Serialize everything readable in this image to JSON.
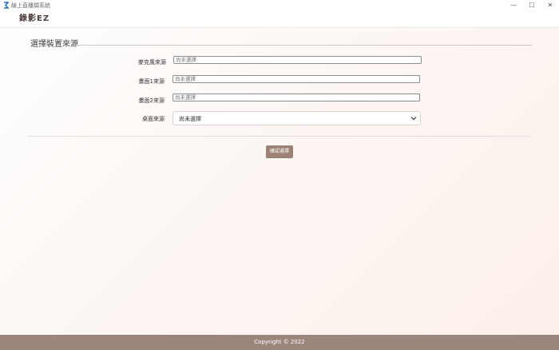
{
  "window": {
    "title": "線上直播擷系統",
    "minimize_glyph": "—",
    "maximize_glyph": "☐",
    "close_glyph": "✕"
  },
  "header": {
    "brand": "錄影EZ"
  },
  "form": {
    "section_title": "選擇裝置來源",
    "fields": [
      {
        "label": "麥克風來源",
        "placeholder": "尚未選擇"
      },
      {
        "label": "畫面1來源",
        "placeholder": "尚未選擇"
      },
      {
        "label": "畫面2來源",
        "placeholder": "尚未選擇"
      }
    ],
    "desktop": {
      "label": "桌面來源",
      "selected": "尚未選擇"
    },
    "confirm_label": "確認選擇"
  },
  "footer": {
    "copyright": "Copyright © 2022"
  },
  "colors": {
    "accent": "#9d8175",
    "footer_bg": "#9b857c"
  },
  "icons": {
    "app": "app-icon",
    "chevron": "chevron-down-icon"
  }
}
